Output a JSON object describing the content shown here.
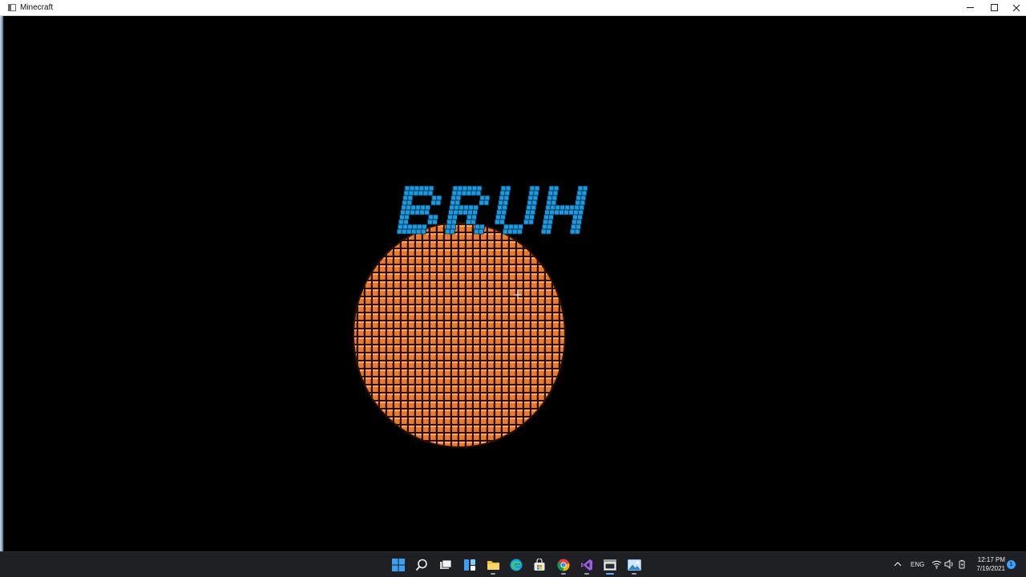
{
  "window": {
    "title": "Minecraft",
    "controls": [
      "minimize",
      "maximize",
      "close"
    ]
  },
  "scene": {
    "background_color": "#000000",
    "text": "BRUH",
    "text_block_color": "#1a9ae0",
    "sphere_block_color": "#f07d2a"
  },
  "taskbar": {
    "apps": [
      {
        "name": "start",
        "icon": "windows-logo-icon"
      },
      {
        "name": "search",
        "icon": "search-icon"
      },
      {
        "name": "task-view",
        "icon": "task-view-icon"
      },
      {
        "name": "widgets",
        "icon": "widgets-icon"
      },
      {
        "name": "file-explorer",
        "icon": "folder-icon",
        "running": true
      },
      {
        "name": "edge",
        "icon": "edge-icon"
      },
      {
        "name": "store",
        "icon": "store-icon"
      },
      {
        "name": "chrome",
        "icon": "chrome-icon",
        "running": true
      },
      {
        "name": "visual-studio",
        "icon": "visual-studio-icon",
        "running": true
      },
      {
        "name": "minecraft",
        "icon": "minecraft-window-icon",
        "running": true,
        "active": true
      },
      {
        "name": "photos",
        "icon": "photos-icon",
        "running": true
      }
    ],
    "tray": {
      "language": "ENG",
      "icons": [
        "chevron-up-icon",
        "wifi-icon",
        "volume-icon",
        "battery-icon"
      ]
    },
    "clock": {
      "time": "12:17 PM",
      "date": "7/19/2021"
    },
    "notification_count": "1",
    "accent_color": "#36a3ff"
  }
}
